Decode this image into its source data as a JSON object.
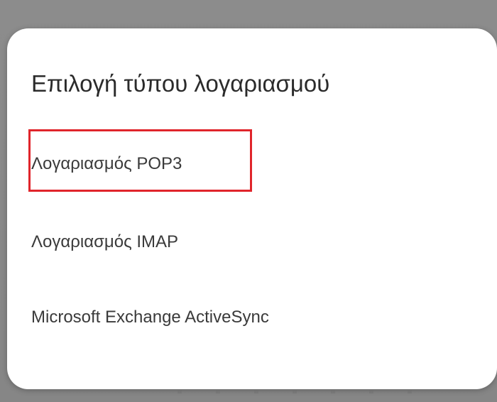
{
  "dialog": {
    "title": "Επιλογή τύπου λογαριασμού",
    "options": [
      {
        "label": "Λογαριασμός POP3",
        "highlighted": true
      },
      {
        "label": "Λογαριασμός IMAP",
        "highlighted": false
      },
      {
        "label": "Microsoft Exchange ActiveSync",
        "highlighted": false
      }
    ]
  },
  "colors": {
    "backdrop": "#8a8a8a",
    "dialog": "#ffffff",
    "highlight": "#e0252b",
    "text": "#3a3a3a"
  }
}
